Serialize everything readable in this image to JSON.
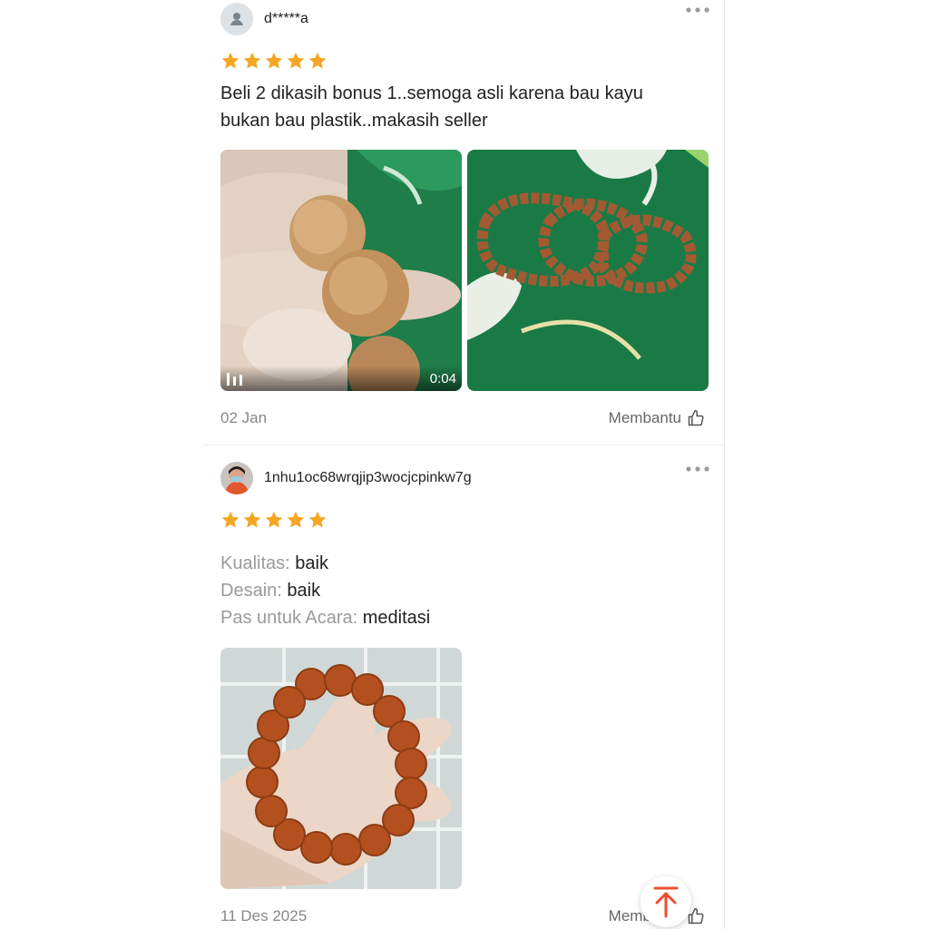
{
  "reviews": [
    {
      "username": "d*****a",
      "rating": 5,
      "text": "Beli 2 dikasih bonus 1..semoga asli karena bau kayu bukan bau plastik..makasih seller",
      "video_duration": "0:04",
      "date": "02 Jan",
      "helpful_label": "Membantu"
    },
    {
      "username": "1nhu1oc68wrqjip3wocjcpinkw7g",
      "rating": 5,
      "attributes": [
        {
          "key": "Kualitas:",
          "value": "baik"
        },
        {
          "key": "Desain:",
          "value": "baik"
        },
        {
          "key": "Pas untuk Acara:",
          "value": "meditasi"
        }
      ],
      "date": "11 Des 2025",
      "helpful_label": "Membantu"
    }
  ],
  "colors": {
    "star": "#f5a623",
    "accent": "#ee4d2d",
    "muted_text": "#9a9a9a"
  },
  "icons": {
    "more": "more-dots-icon",
    "helpful": "thumbs-up-icon",
    "back_to_top": "arrow-up-icon",
    "video": "video-bars-icon"
  }
}
